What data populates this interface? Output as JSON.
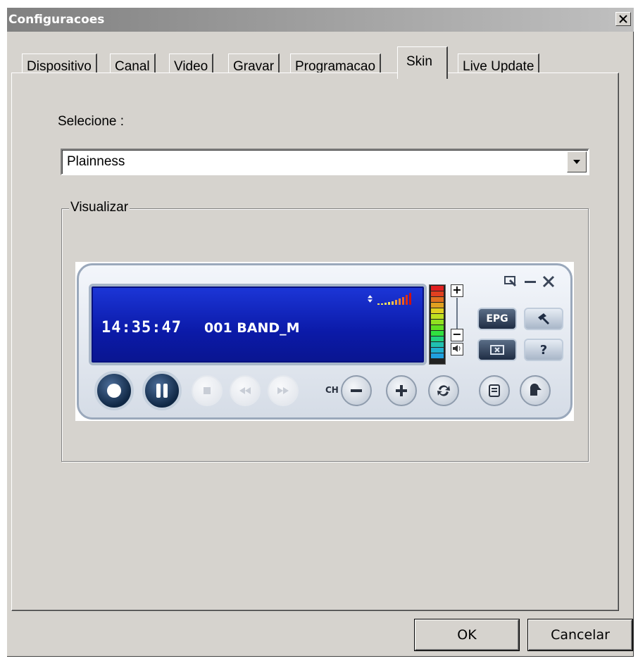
{
  "window": {
    "title": "Configuracoes",
    "close_glyph": "✕"
  },
  "tabs": [
    {
      "label": "Dispositivo"
    },
    {
      "label": "Canal"
    },
    {
      "label": "Video"
    },
    {
      "label": "Gravar"
    },
    {
      "label": "Programacao"
    },
    {
      "label": "Skin",
      "active": true
    },
    {
      "label": "Live Update"
    }
  ],
  "skin": {
    "select_label": "Selecione :",
    "selected_value": "Plainness",
    "preview_legend": "Visualizar"
  },
  "player_preview": {
    "time": "14:35:47",
    "channel": "001 BAND_M",
    "ch_label": "CH",
    "epg_label": "EPG",
    "help_label": "?",
    "vol_plus": "+",
    "vol_minus": "−"
  },
  "buttons": {
    "ok": "OK",
    "cancel": "Cancelar"
  }
}
